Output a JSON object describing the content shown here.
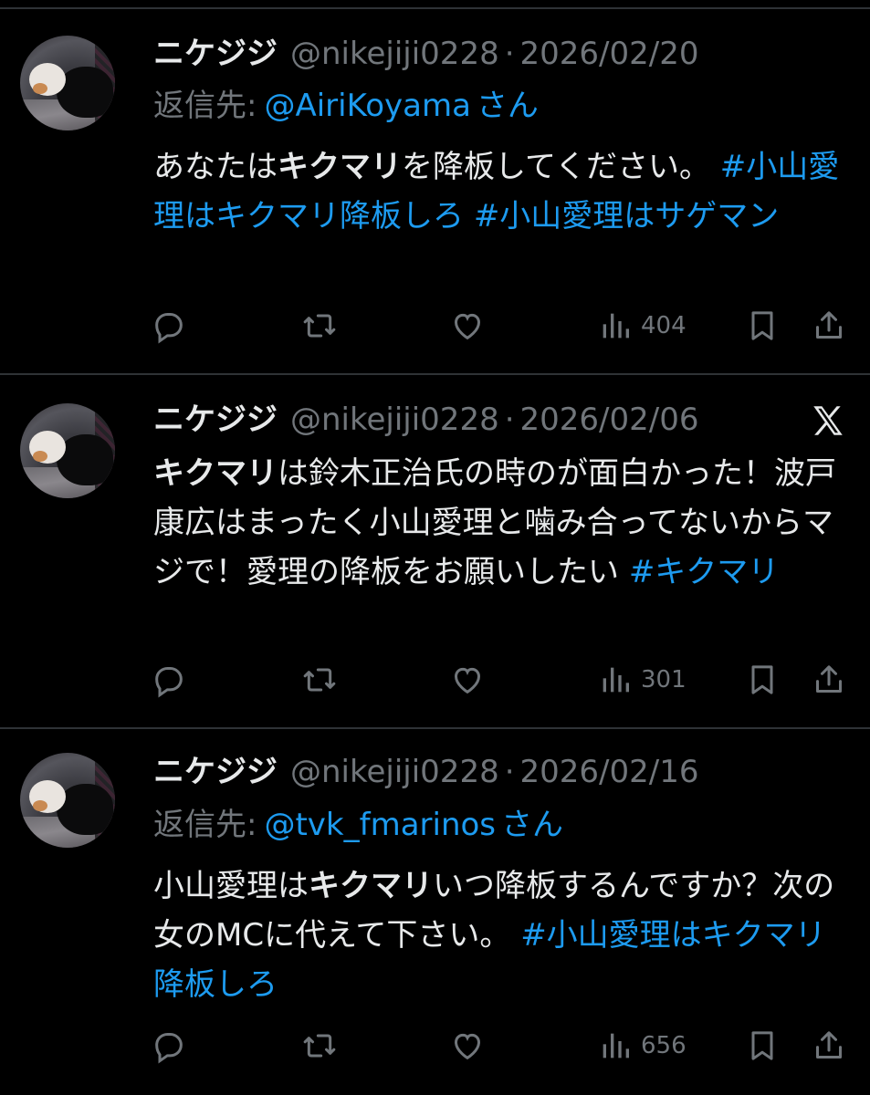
{
  "tweets": [
    {
      "name": "ニケジジ",
      "handle": "@nikejiji0228",
      "dot": "·",
      "date": "2026/02/20",
      "reply_prefix": "返信先:",
      "reply_to": "@AiriKoyama",
      "reply_suffix": "さん",
      "text": {
        "p1": "あなたは",
        "b1": "キクマリ",
        "p2": "を降板してください。",
        "tag1": "#小山愛理はキクマリ降板しろ",
        "tag2": "#小山愛理はサゲマン"
      },
      "views": "404"
    },
    {
      "name": "ニケジジ",
      "handle": "@nikejiji0228",
      "dot": "·",
      "date": "2026/02/06",
      "text": {
        "b1": "キクマリ",
        "p1": "は鈴木正治氏の時のが面白かった！波戸康広はまったく小山愛理と噛み合ってないからマジで！愛理の降板をお願いしたい",
        "tag1": "#キクマリ"
      },
      "views": "301",
      "platform_icon": "x-logo-icon"
    },
    {
      "name": "ニケジジ",
      "handle": "@nikejiji0228",
      "dot": "·",
      "date": "2026/02/16",
      "reply_prefix": "返信先:",
      "reply_to": "@tvk_fmarinos",
      "reply_suffix": "さん",
      "text": {
        "p1": "小山愛理は",
        "b1": "キクマリ",
        "p2": "いつ降板するんですか？次の女のMCに代えて下さい。",
        "tag1": "#小山愛理はキクマリ降板しろ"
      },
      "views": "656"
    }
  ],
  "icons": [
    "reply-icon",
    "retweet-icon",
    "like-icon",
    "views-icon",
    "bookmark-icon",
    "share-icon"
  ],
  "colors": {
    "background": "#000000",
    "text": "#e7e9ea",
    "muted": "#71767b",
    "link": "#1d9bf0",
    "divider": "#2f3336"
  }
}
